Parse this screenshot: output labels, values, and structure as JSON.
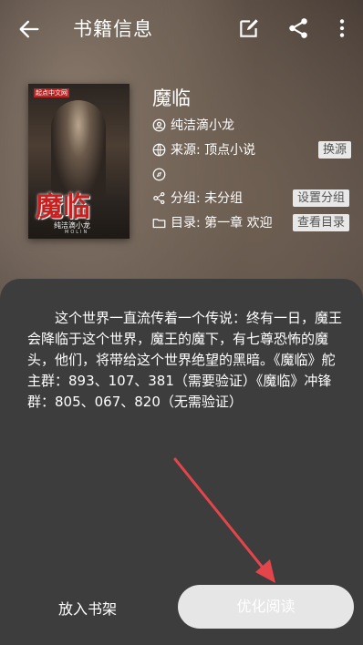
{
  "header": {
    "title": "书籍信息"
  },
  "book": {
    "cover_tag": "起点中文网",
    "cover_title": "魔临",
    "cover_author": "纯洁滴小龙",
    "cover_eng": "MOLIN",
    "name": "魔临",
    "author": "纯洁滴小龙",
    "source": "来源: 顶点小说",
    "link": "",
    "group": "分组: 未分组",
    "toc": "目录: 第一章 欢迎"
  },
  "chips": {
    "source": "换源",
    "group": "设置分组",
    "toc": "查看目录"
  },
  "intro": "这个世界一直流传着一个传说：终有一日，魔王会降临于这个世界，魔王的魔下，有七尊恐怖的魔头，他们，将带给这个世界绝望的黑暗。《魔临》舵主群：893、107、381（需要验证）《魔临》冲锋群：805、067、820（无需验证）",
  "actions": {
    "shelf": "放入书架",
    "read": "优化阅读"
  },
  "colors": {
    "accent_arrow": "#e3454a",
    "sheet": "#3d3d3d"
  }
}
